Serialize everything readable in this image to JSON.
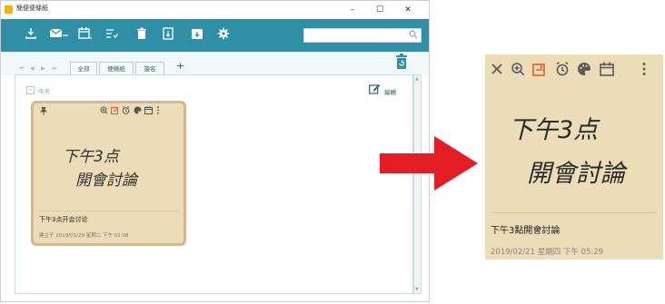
{
  "window": {
    "title": "簡便便條紙",
    "controls": {
      "minimize": "–",
      "maximize": "☐",
      "close": "✕"
    }
  },
  "toolbar": {
    "icons": [
      "download-icon",
      "mail-icon",
      "calendar-icon",
      "checklist-icon",
      "trash-icon",
      "export-icon",
      "archive-icon",
      "gear-icon"
    ],
    "search_placeholder": ""
  },
  "tabs": {
    "nav": [
      "⏮",
      "◀",
      "▶",
      "⏭"
    ],
    "items": [
      {
        "label": "全部"
      },
      {
        "label": "便條紙"
      },
      {
        "label": "簽名"
      }
    ],
    "add_label": "+"
  },
  "group": {
    "collapse": "–",
    "label": "今天",
    "edit_label": "編輯"
  },
  "note": {
    "handwriting_line1": "下午3点",
    "handwriting_line2": "開會討論",
    "title": "下午3点开会讨论",
    "date": "建立于 2019/01/29 星期二 下午 02:08",
    "colors": {
      "background": "#ecdcb8",
      "border": "#d3b98c"
    }
  },
  "zoomed_note": {
    "handwriting_line1": "下午3点",
    "handwriting_line2": "開會討論",
    "title": "下午3點開會討論",
    "date": "2019/02/21 星期四 下午 05:29"
  },
  "colors": {
    "toolbar": "#2f8fa6",
    "arrow": "#e31d23"
  }
}
